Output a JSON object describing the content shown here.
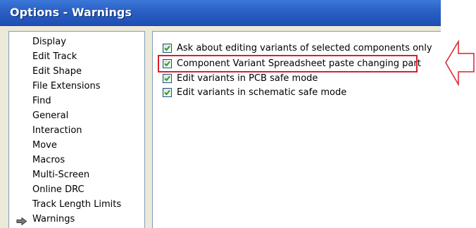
{
  "window": {
    "title": "Options - Warnings"
  },
  "sidebar": {
    "items": [
      {
        "label": "Display",
        "selected": false
      },
      {
        "label": "Edit Track",
        "selected": false
      },
      {
        "label": "Edit Shape",
        "selected": false
      },
      {
        "label": "File Extensions",
        "selected": false
      },
      {
        "label": "Find",
        "selected": false
      },
      {
        "label": "General",
        "selected": false
      },
      {
        "label": "Interaction",
        "selected": false
      },
      {
        "label": "Move",
        "selected": false
      },
      {
        "label": "Macros",
        "selected": false
      },
      {
        "label": "Multi-Screen",
        "selected": false
      },
      {
        "label": "Online DRC",
        "selected": false
      },
      {
        "label": "Track Length Limits",
        "selected": false
      },
      {
        "label": "Warnings",
        "selected": true,
        "indicator_icon": "arrow-right-icon"
      }
    ]
  },
  "warnings": {
    "options": [
      {
        "label": "Ask about editing variants of selected components only",
        "checked": true
      },
      {
        "label": "Component Variant Spreadsheet paste changing part",
        "checked": true,
        "highlighted": true
      },
      {
        "label": "Edit variants in PCB safe mode",
        "checked": true
      },
      {
        "label": "Edit variants in schematic safe mode",
        "checked": true
      }
    ]
  },
  "annotation": {
    "highlight_color": "#d8202a",
    "arrow_icon": "callout-arrow-left-icon"
  },
  "colors": {
    "titlebar": "#2a5fc4",
    "checkmark": "#21a121",
    "panel_border": "#7f9db9",
    "window_bg": "#ece9d8"
  }
}
